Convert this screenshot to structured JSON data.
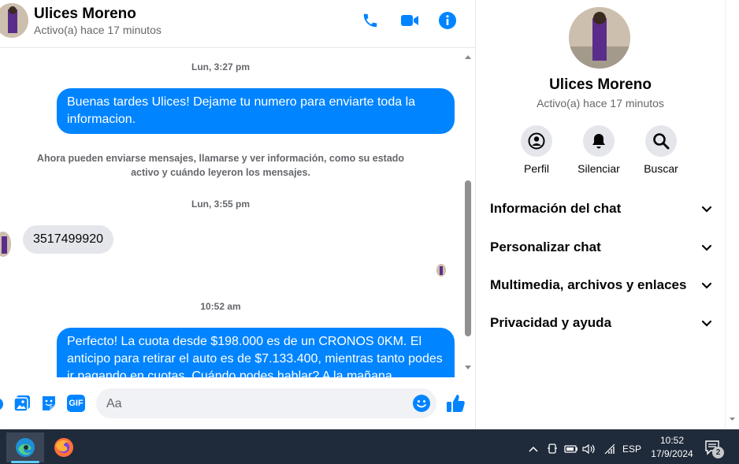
{
  "colors": {
    "accent": "#0084ff",
    "bubble_in": "#e4e6eb",
    "taskbar": "#1f2a3a"
  },
  "header": {
    "name": "Ulices Moreno",
    "status": "Activo(a) hace 17 minutos",
    "icons": [
      "phone-icon",
      "video-icon",
      "info-icon"
    ]
  },
  "messages": {
    "time1": "Lun, 3:27 pm",
    "out1": "Buenas tardes Ulices! Dejame tu numero para enviarte toda la informacion.",
    "system_note": "Ahora pueden enviarse mensajes, llamarse y ver información, como su estado activo y cuándo leyeron los mensajes.",
    "time2": "Lun, 3:55 pm",
    "in1": "3517499920",
    "time3": "10:52 am",
    "out2": "Perfecto! La cuota desde $198.000 es de un CRONOS 0KM. El anticipo para retirar el auto es de $7.133.400, mientras tanto podes ir pagando en cuotas. Cuándo podes hablar? A la mañana"
  },
  "composer": {
    "placeholder": "Aa",
    "gif_label": "GIF",
    "icons": [
      "plus-icon",
      "image-icon",
      "sticker-icon",
      "gif-icon",
      "emoji-icon",
      "like-icon"
    ]
  },
  "panel": {
    "name": "Ulices Moreno",
    "status": "Activo(a) hace 17 minutos",
    "actions": [
      {
        "label": "Perfil",
        "icon": "profile-icon"
      },
      {
        "label": "Silenciar",
        "icon": "bell-icon"
      },
      {
        "label": "Buscar",
        "icon": "search-icon"
      }
    ],
    "sections": [
      "Información del chat",
      "Personalizar chat",
      "Multimedia, archivos y enlaces",
      "Privacidad y ayuda"
    ]
  },
  "taskbar": {
    "apps": [
      "edge-icon",
      "firefox-icon"
    ],
    "lang": "ESP",
    "time": "10:52",
    "date": "17/9/2024",
    "notifications": "2"
  }
}
